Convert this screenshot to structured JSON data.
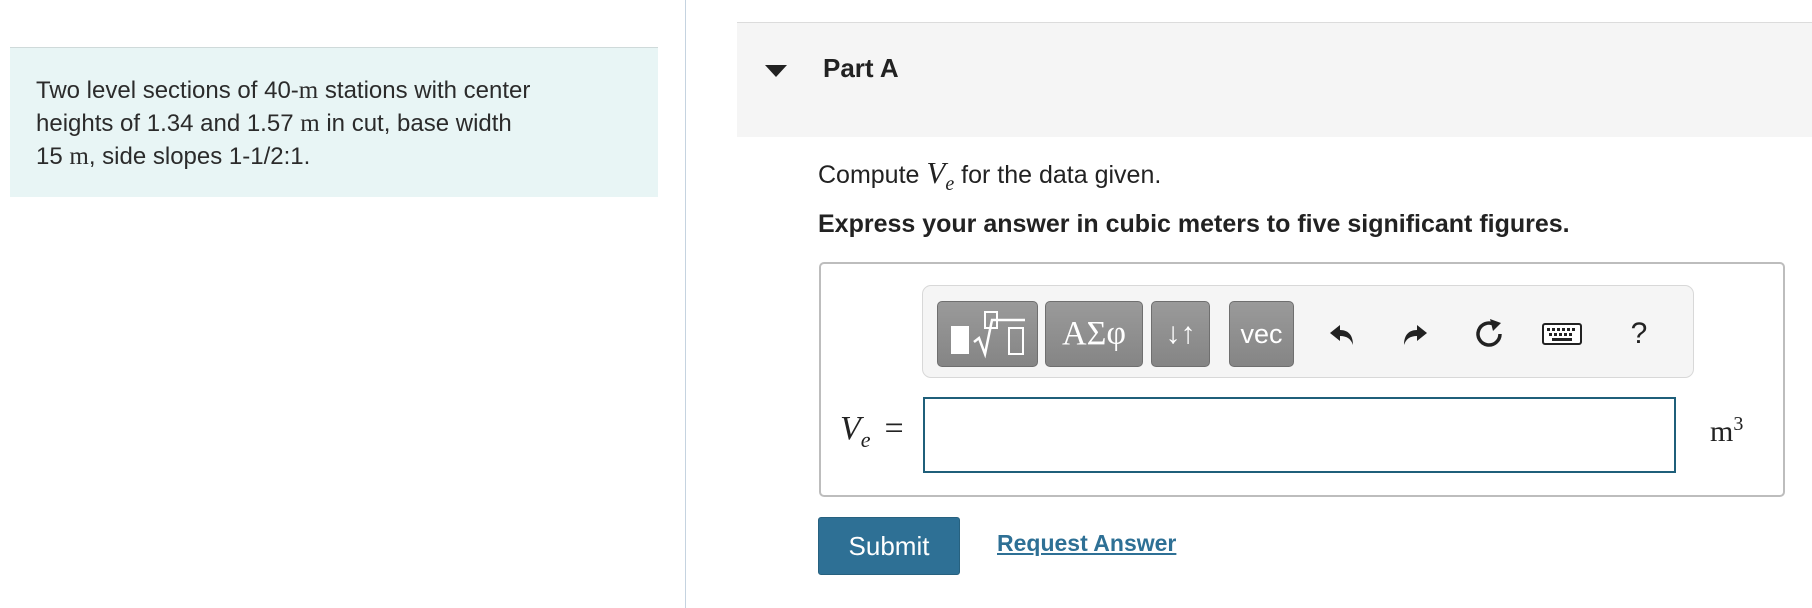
{
  "problem": {
    "text_1": "Two level sections of 40-",
    "unit_m": "m",
    "text_2": " stations with center",
    "text_3": "heights of 1.34 and 1.57 ",
    "text_4": " in cut, base width",
    "text_5": "15 ",
    "text_6": ", side slopes 1-1/2:1."
  },
  "part": {
    "title": "Part A",
    "prompt_before": "Compute ",
    "var_main": "V",
    "var_sub": "e",
    "prompt_after": " for the data given.",
    "instruction": "Express your answer in cubic meters to five significant figures."
  },
  "toolbar": {
    "greek_label": "ΑΣφ",
    "arrows_label": "↓↑",
    "vec_label": "vec",
    "help_label": "?"
  },
  "answer": {
    "label_main": "V",
    "label_sub": "e",
    "equals": "=",
    "value": "",
    "unit_main": "m",
    "unit_exp": "3"
  },
  "actions": {
    "submit_label": "Submit",
    "request_label": "Request Answer"
  },
  "colors": {
    "problem_bg": "#e8f5f5",
    "primary": "#2e7095",
    "toolbar_button": "#8e8e8e"
  }
}
